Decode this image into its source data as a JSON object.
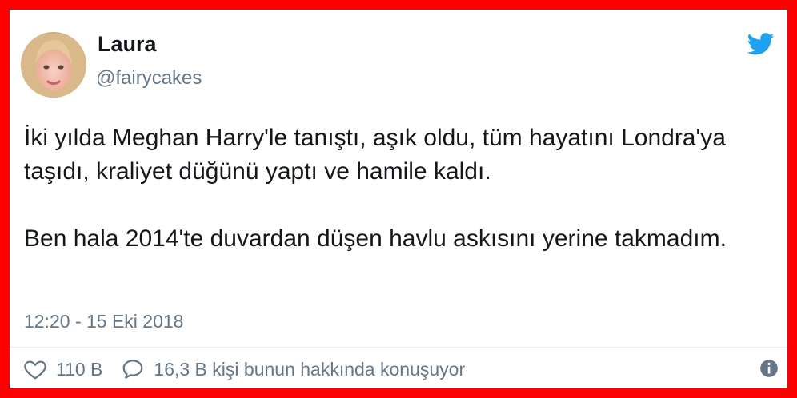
{
  "user": {
    "name": "Laura",
    "handle": "@fairycakes"
  },
  "tweet": {
    "paragraphs": [
      "İki yılda Meghan Harry'le tanıştı, aşık oldu, tüm hayatını Londra'ya taşıdı, kraliyet düğünü yaptı ve hamile kaldı.",
      "Ben hala 2014'te duvardan düşen havlu askısını yerine takmadım."
    ],
    "timestamp": "12:20 - 15 Eki 2018"
  },
  "actions": {
    "likes": "110 B",
    "replies": "16,3 B kişi bunun hakkında konuşuyor"
  },
  "icons": {
    "brand": "twitter-bird-icon",
    "like": "heart-icon",
    "reply": "speech-bubble-icon",
    "info": "info-icon"
  },
  "colors": {
    "frame": "#ff0000",
    "brand": "#1da1f2",
    "text": "#14171a",
    "muted": "#657786"
  }
}
